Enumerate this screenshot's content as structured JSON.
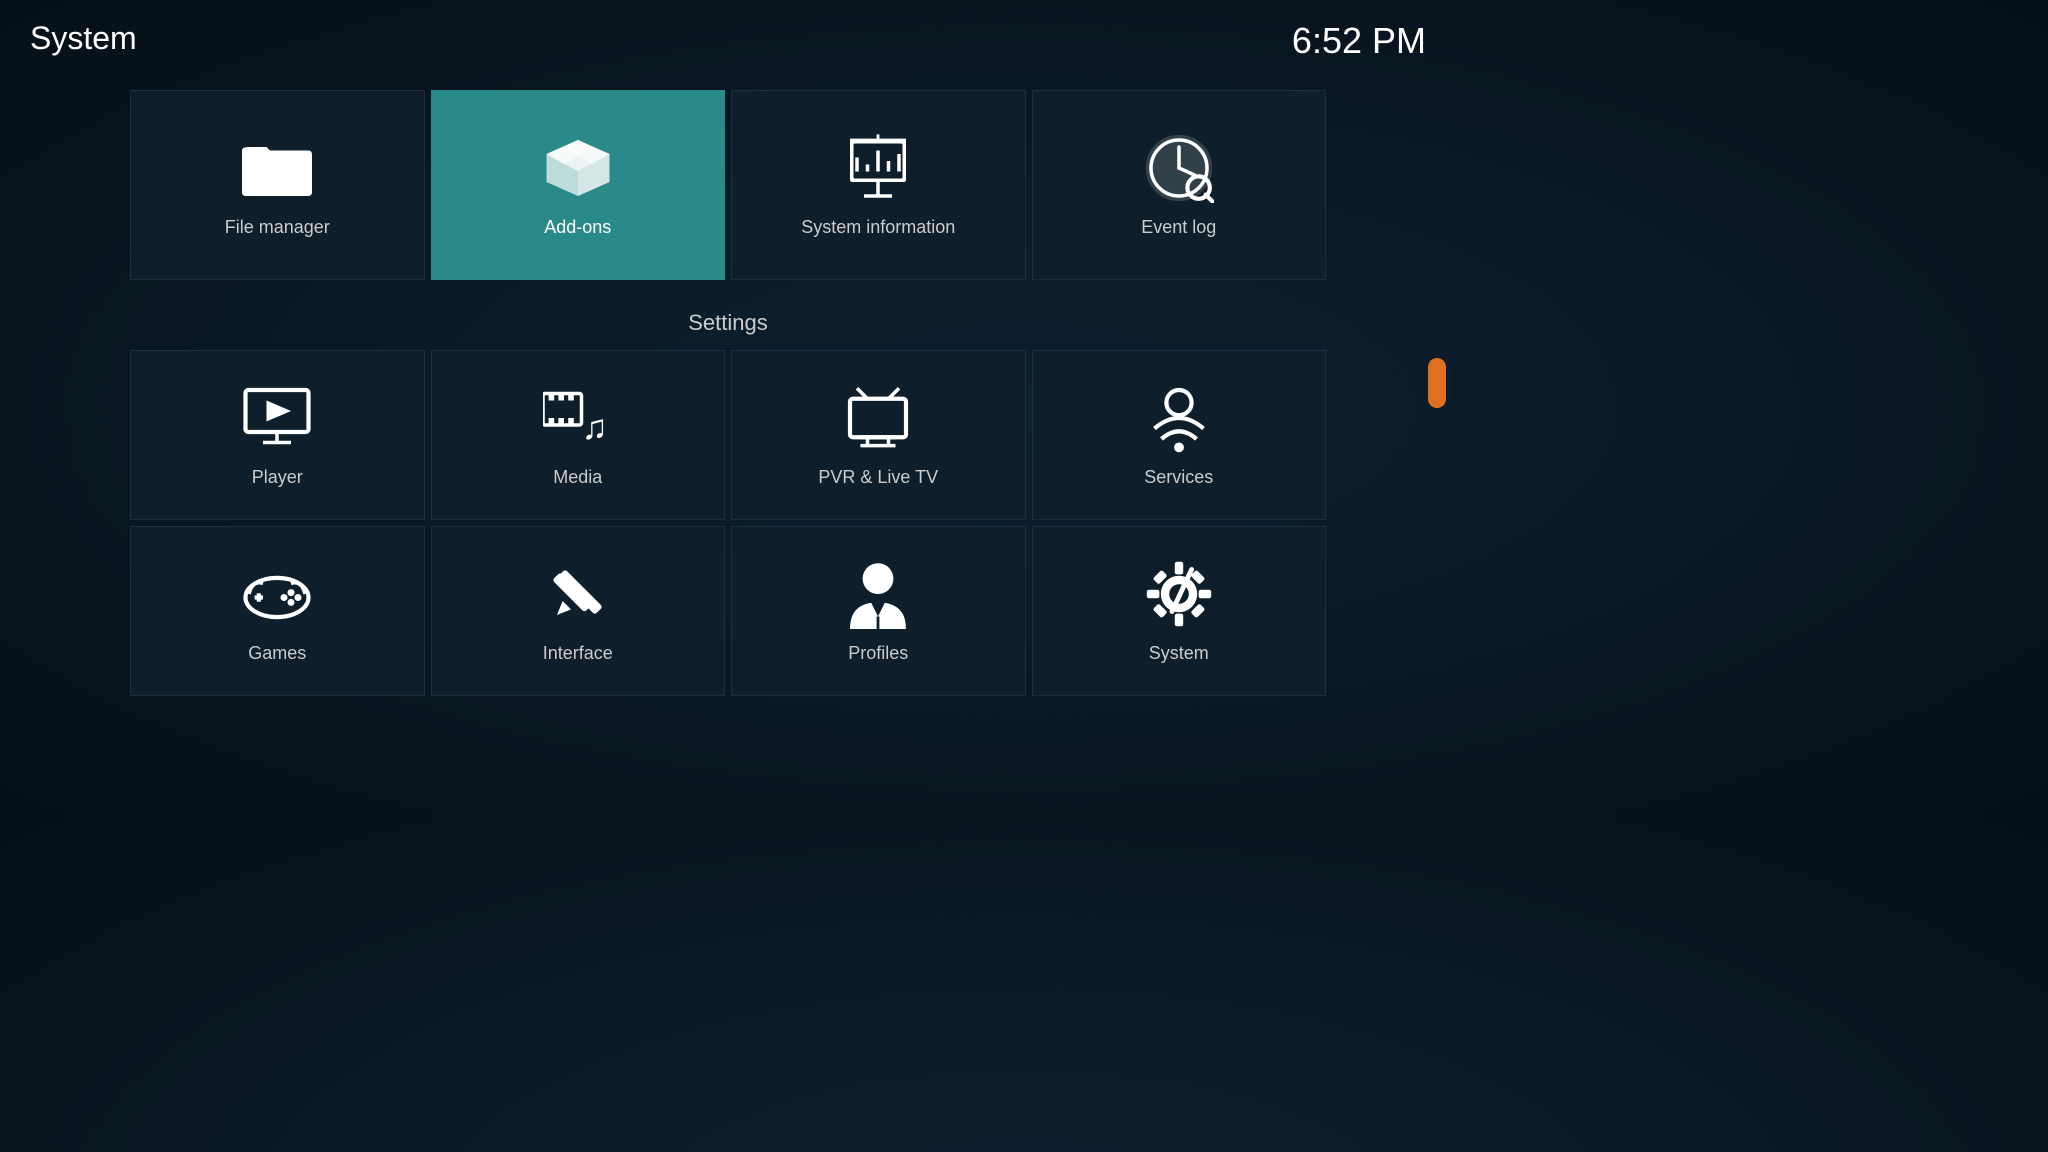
{
  "header": {
    "title": "System",
    "time": "6:52 PM"
  },
  "top_tiles": [
    {
      "id": "file-manager",
      "label": "File manager",
      "icon": "folder"
    },
    {
      "id": "add-ons",
      "label": "Add-ons",
      "icon": "addons",
      "active": true
    },
    {
      "id": "system-information",
      "label": "System information",
      "icon": "sysinfo"
    },
    {
      "id": "event-log",
      "label": "Event log",
      "icon": "eventlog"
    }
  ],
  "settings_label": "Settings",
  "bottom_tiles": [
    {
      "id": "player",
      "label": "Player",
      "icon": "player"
    },
    {
      "id": "media",
      "label": "Media",
      "icon": "media"
    },
    {
      "id": "pvr-live-tv",
      "label": "PVR & Live TV",
      "icon": "pvr"
    },
    {
      "id": "services",
      "label": "Services",
      "icon": "services"
    },
    {
      "id": "games",
      "label": "Games",
      "icon": "games"
    },
    {
      "id": "interface",
      "label": "Interface",
      "icon": "interface"
    },
    {
      "id": "profiles",
      "label": "Profiles",
      "icon": "profiles"
    },
    {
      "id": "system",
      "label": "System",
      "icon": "system"
    }
  ]
}
